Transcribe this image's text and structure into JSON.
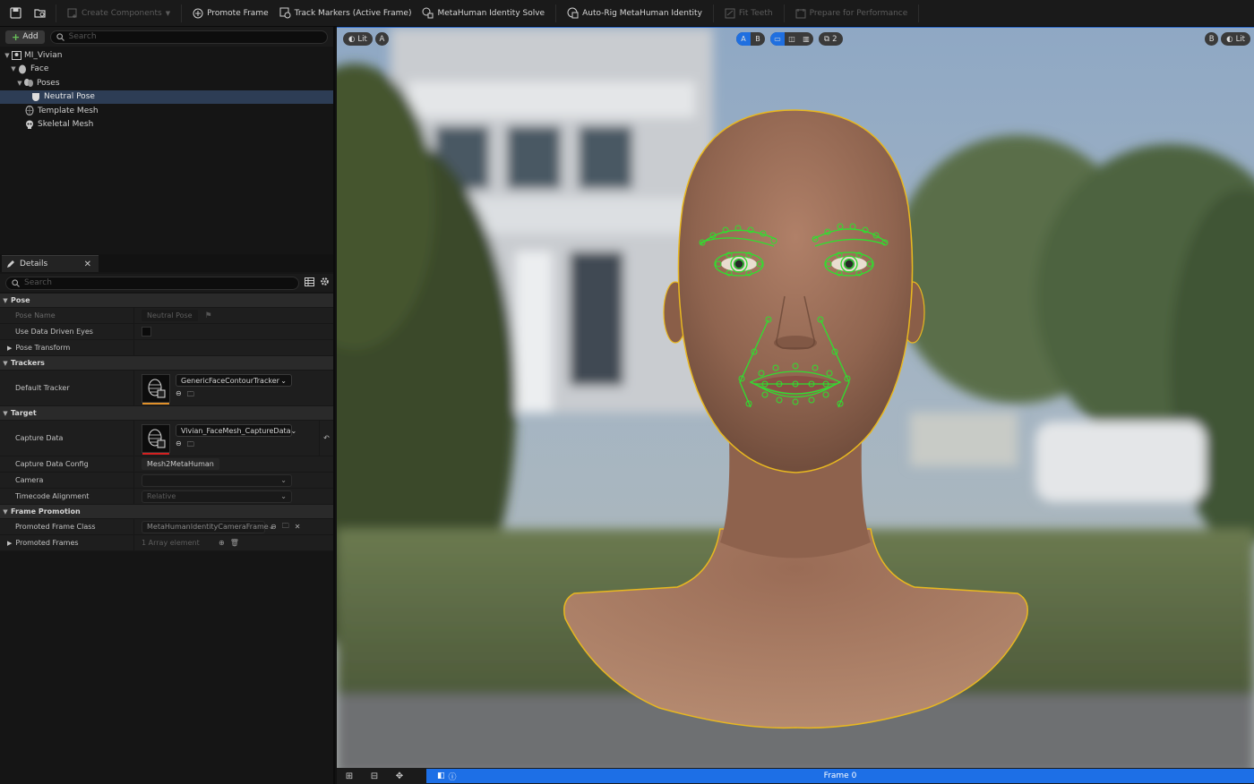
{
  "toolbar": {
    "create_components": "Create Components",
    "promote_frame": "Promote Frame",
    "track_markers": "Track Markers (Active Frame)",
    "identity_solve": "MetaHuman Identity Solve",
    "auto_rig": "Auto-Rig MetaHuman Identity",
    "fit_teeth": "Fit Teeth",
    "prepare_performance": "Prepare for Performance"
  },
  "outliner": {
    "add_label": "Add",
    "search_placeholder": "Search",
    "items": [
      {
        "label": "MI_Vivian"
      },
      {
        "label": "Face"
      },
      {
        "label": "Poses"
      },
      {
        "label": "Neutral Pose"
      },
      {
        "label": "Template Mesh"
      },
      {
        "label": "Skeletal Mesh"
      }
    ]
  },
  "details": {
    "tab_label": "Details",
    "search_placeholder": "Search",
    "pose": {
      "header": "Pose",
      "pose_name_label": "Pose Name",
      "pose_name_value": "Neutral Pose",
      "use_data_driven_eyes_label": "Use Data Driven Eyes",
      "pose_transform_label": "Pose Transform"
    },
    "trackers": {
      "header": "Trackers",
      "default_tracker_label": "Default Tracker",
      "default_tracker_value": "GenericFaceContourTracker"
    },
    "target": {
      "header": "Target",
      "capture_data_label": "Capture Data",
      "capture_data_value": "Vivian_FaceMesh_CaptureData",
      "capture_data_config_label": "Capture Data Config",
      "capture_data_config_value": "Mesh2MetaHuman",
      "camera_label": "Camera",
      "camera_value": "",
      "timecode_alignment_label": "Timecode Alignment",
      "timecode_alignment_value": "Relative"
    },
    "frame_promotion": {
      "header": "Frame Promotion",
      "promoted_frame_class_label": "Promoted Frame Class",
      "promoted_frame_class_value": "MetaHumanIdentityCameraFrame",
      "promoted_frames_label": "Promoted Frames",
      "promoted_frames_value": "1 Array element"
    }
  },
  "viewport": {
    "lit_left": "Lit",
    "a_left": "A",
    "a_center": "A",
    "b_center": "B",
    "view_count": "2",
    "b_right": "B",
    "lit_right": "Lit"
  },
  "bottom": {
    "frame_label": "Frame 0"
  },
  "colors": {
    "accent_blue": "#1f6fe0",
    "tracker_green": "#2fe02f",
    "outline_yellow": "#f0c020"
  }
}
